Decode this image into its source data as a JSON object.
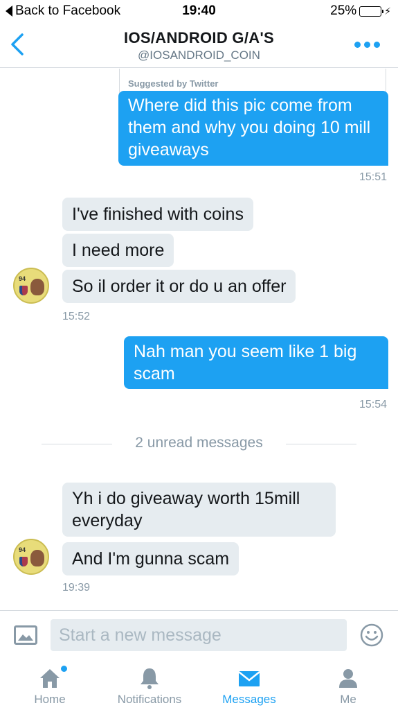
{
  "status_bar": {
    "back_label": "Back to Facebook",
    "time": "19:40",
    "battery_percent": "25%",
    "battery_level": 0.25,
    "battery_color": "#f5c400"
  },
  "header": {
    "title": "IOS/ANDROID G/A'S",
    "handle": "@IOSANDROID_COIN",
    "back_icon": "chevron-left-icon",
    "more_icon": "more-dots-icon"
  },
  "conversation": {
    "suggested_label": "Suggested by Twitter",
    "messages": [
      {
        "direction": "out",
        "text": "Where did this pic come from them and why you doing 10 mill giveaways",
        "time": "15:51"
      },
      {
        "direction": "in",
        "text": "I've finished with coins"
      },
      {
        "direction": "in",
        "text": "I need more"
      },
      {
        "direction": "in",
        "text": "So il order it or do u an offer",
        "time": "15:52"
      },
      {
        "direction": "out",
        "text": "Nah man you seem like 1 big scam",
        "time": "15:54"
      },
      {
        "direction": "in",
        "text": "Yh i do giveaway worth 15mill everyday"
      },
      {
        "direction": "in",
        "text": "And I'm gunna scam",
        "time": "19:39"
      }
    ],
    "unread_divider": "2 unread messages",
    "avatar_rating": "94"
  },
  "composer": {
    "placeholder": "Start a new message",
    "value": ""
  },
  "tabs": [
    {
      "label": "Home",
      "icon": "home-icon",
      "active": false,
      "notification_dot": true
    },
    {
      "label": "Notifications",
      "icon": "bell-icon",
      "active": false,
      "notification_dot": false
    },
    {
      "label": "Messages",
      "icon": "envelope-icon",
      "active": true,
      "notification_dot": false
    },
    {
      "label": "Me",
      "icon": "person-icon",
      "active": false,
      "notification_dot": false
    }
  ],
  "colors": {
    "accent": "#1da1f2",
    "incoming_bubble": "#e6ecf0",
    "muted_text": "#8899a6",
    "divider": "#d6dbe0"
  }
}
